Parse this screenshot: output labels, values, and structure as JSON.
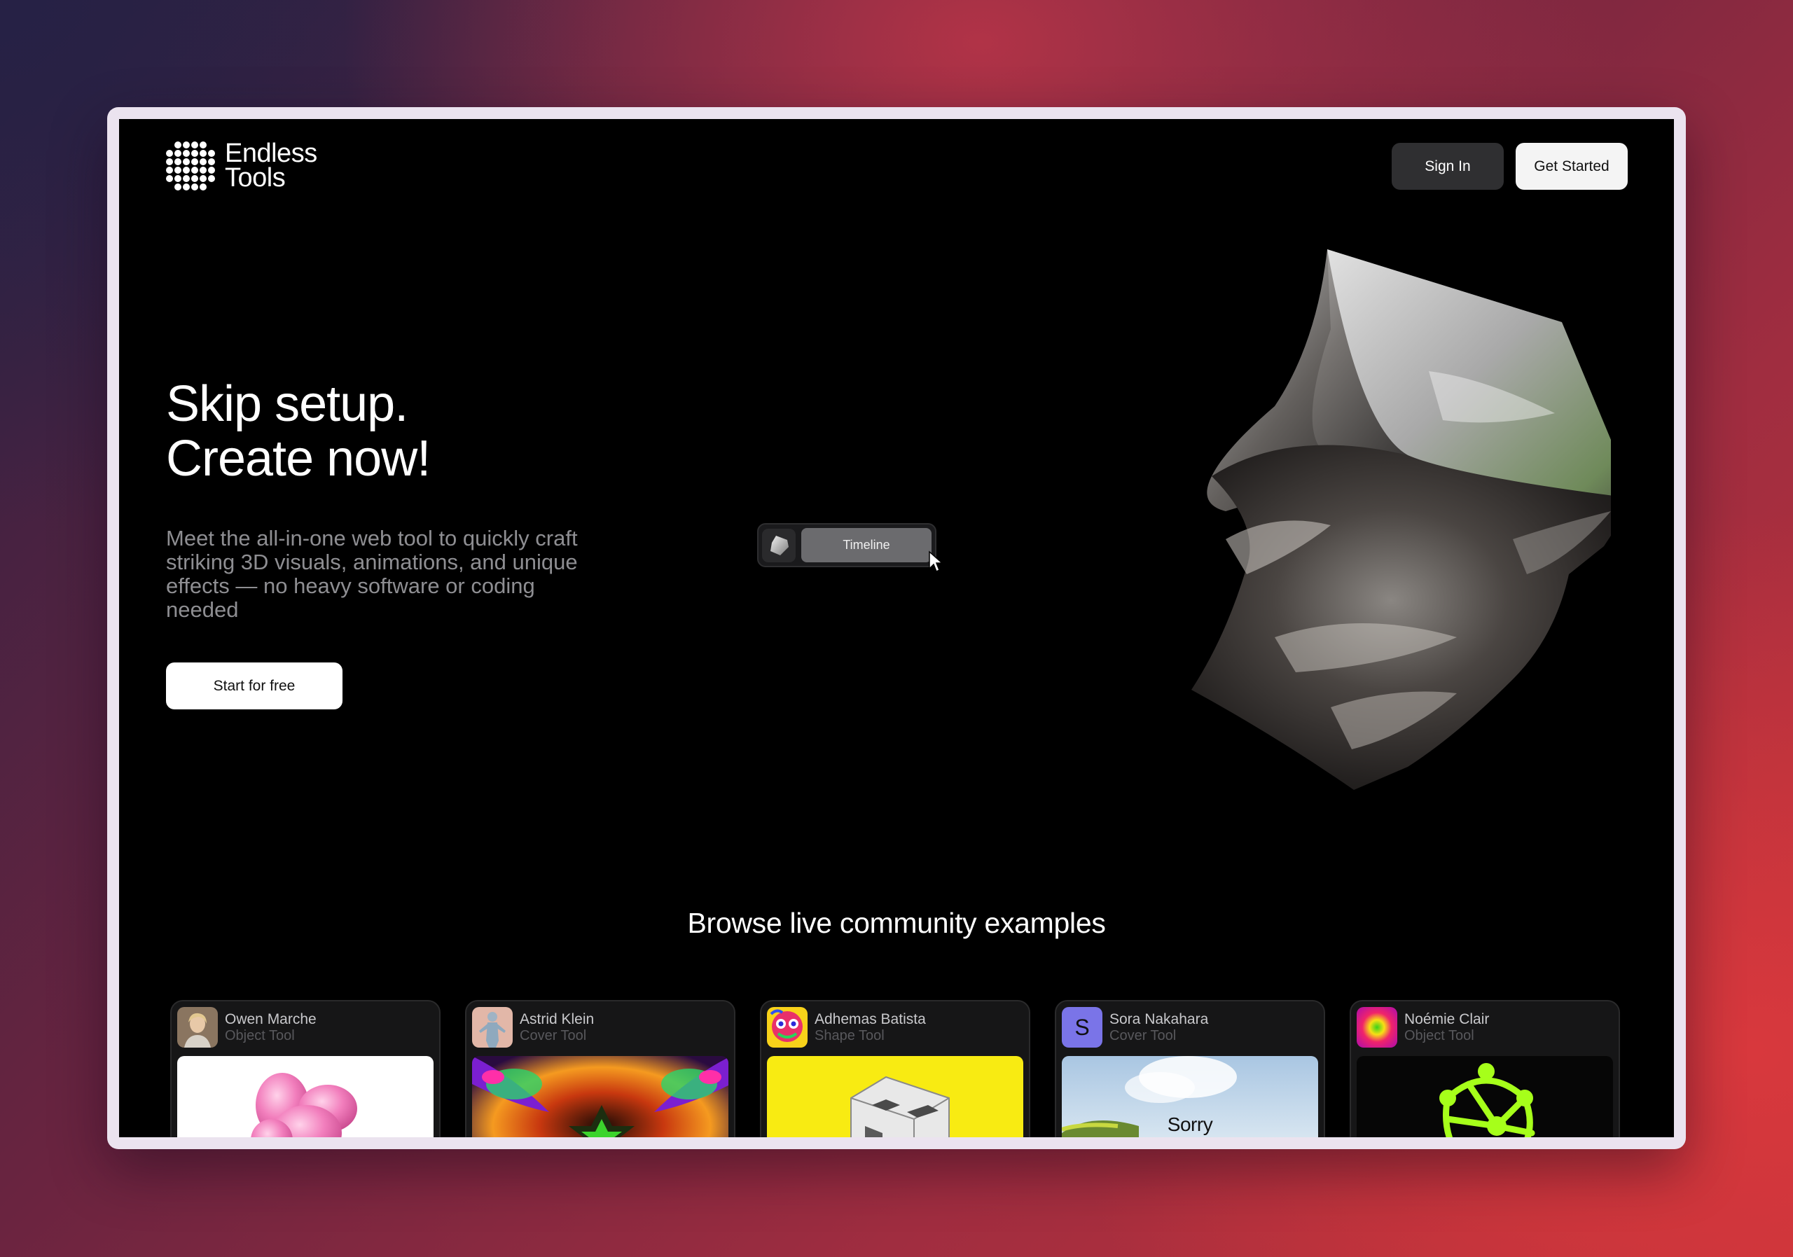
{
  "brand": {
    "name_line1": "Endless",
    "name_line2": "Tools"
  },
  "header": {
    "signin_label": "Sign In",
    "get_started_label": "Get Started"
  },
  "hero": {
    "title_line1": "Skip setup.",
    "title_line2": "Create now!",
    "subtitle": "Meet the all-in-one web tool to quickly craft striking 3D visuals, animations, and unique effects — no heavy software or coding needed",
    "cta_label": "Start for free"
  },
  "timeline_widget": {
    "label": "Timeline"
  },
  "community": {
    "title": "Browse live community examples",
    "cards": [
      {
        "author": "Owen Marche",
        "tool": "Object Tool"
      },
      {
        "author": "Astrid Klein",
        "tool": "Cover Tool"
      },
      {
        "author": "Adhemas Batista",
        "tool": "Shape Tool"
      },
      {
        "author": "Sora Nakahara",
        "tool": "Cover Tool",
        "avatar_letter": "S",
        "preview_text": "Sorry"
      },
      {
        "author": "Noémie Clair",
        "tool": "Object Tool"
      }
    ]
  },
  "colors": {
    "page_bg": "#000000",
    "accent_pink": "#f28bc4",
    "accent_yellow": "#f8eb12",
    "accent_lime": "#a6ff1a"
  }
}
